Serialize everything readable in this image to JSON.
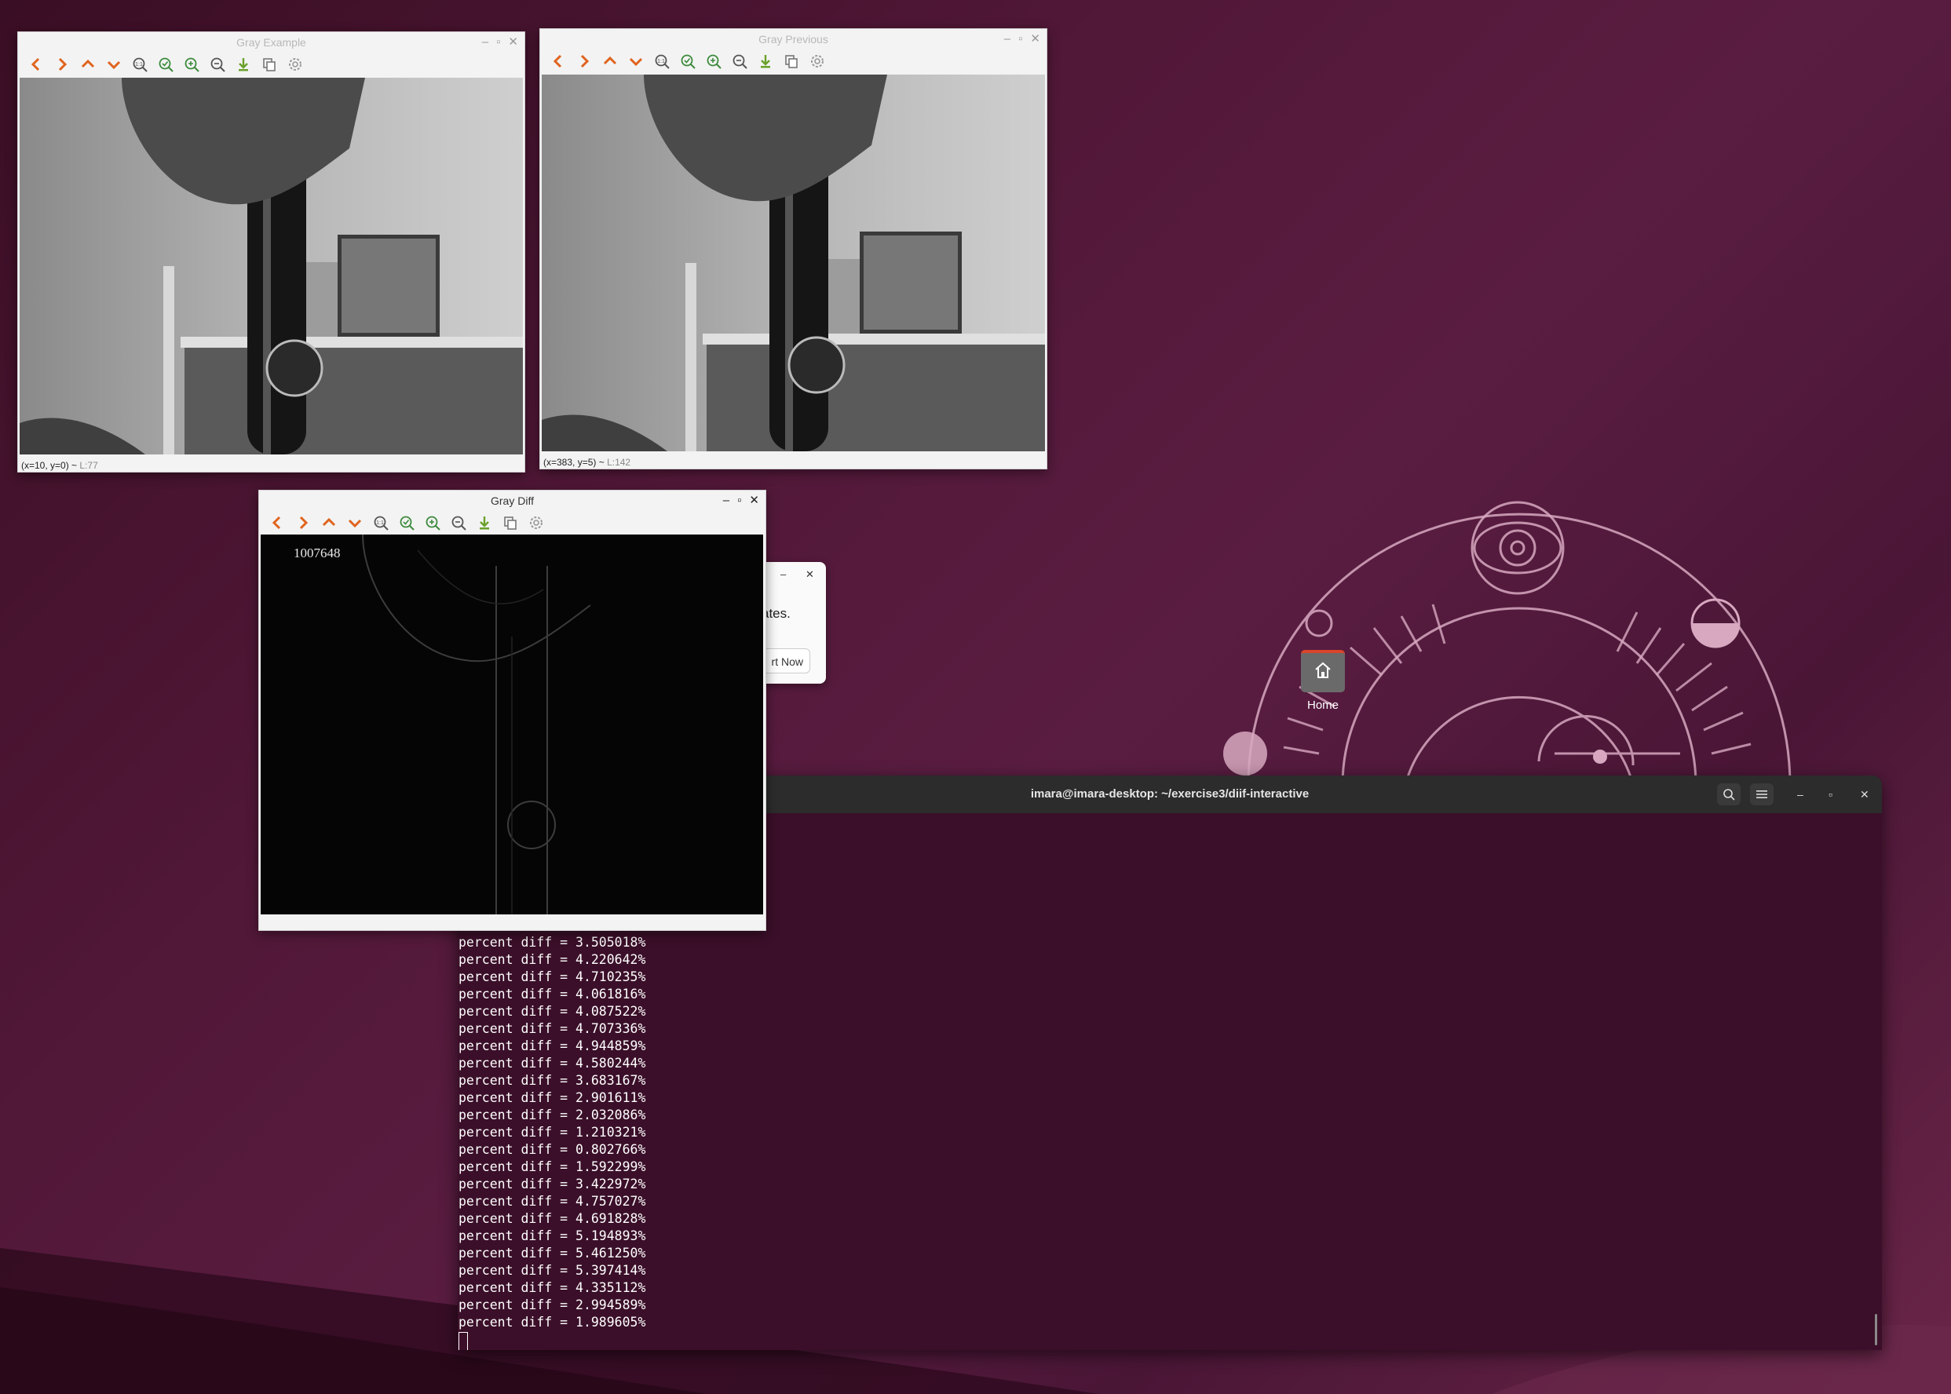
{
  "desktop": {
    "home_label": "Home"
  },
  "windows": {
    "gray_example": {
      "title": "Gray Example",
      "status_coords": "(x=10, y=0) ~",
      "status_value": "L:77"
    },
    "gray_previous": {
      "title": "Gray Previous",
      "status_coords": "(x=383, y=5) ~",
      "status_value": "L:142"
    },
    "gray_diff": {
      "title": "Gray Diff",
      "overlay_number": "1007648"
    }
  },
  "toolbar_icons": [
    "arrow-left-icon",
    "arrow-right-icon",
    "arrow-up-icon",
    "arrow-down-icon",
    "zoom-original-icon",
    "zoom-fit-icon",
    "zoom-in-icon",
    "zoom-out-icon",
    "save-icon",
    "copy-icon",
    "settings-icon"
  ],
  "popup": {
    "message": "ates.",
    "button_label": "rt Now"
  },
  "terminal": {
    "title": "imara@imara-desktop: ~/exercise3/diif-interactive",
    "lines": [
      "percent diff = 3.505018%",
      "percent diff = 4.220642%",
      "percent diff = 4.710235%",
      "percent diff = 4.061816%",
      "percent diff = 4.087522%",
      "percent diff = 4.707336%",
      "percent diff = 4.944859%",
      "percent diff = 4.580244%",
      "percent diff = 3.683167%",
      "percent diff = 2.901611%",
      "percent diff = 2.032086%",
      "percent diff = 1.210321%",
      "percent diff = 0.802766%",
      "percent diff = 1.592299%",
      "percent diff = 3.422972%",
      "percent diff = 4.757027%",
      "percent diff = 4.691828%",
      "percent diff = 5.194893%",
      "percent diff = 5.461250%",
      "percent diff = 5.397414%",
      "percent diff = 4.335112%",
      "percent diff = 2.994589%",
      "percent diff = 1.989605%"
    ]
  },
  "colors": {
    "desktop_bg": "#521838",
    "terminal_bg": "#3b0f29",
    "nav_orange": "#e0641e",
    "zoom_green": "#3c8a3c"
  }
}
